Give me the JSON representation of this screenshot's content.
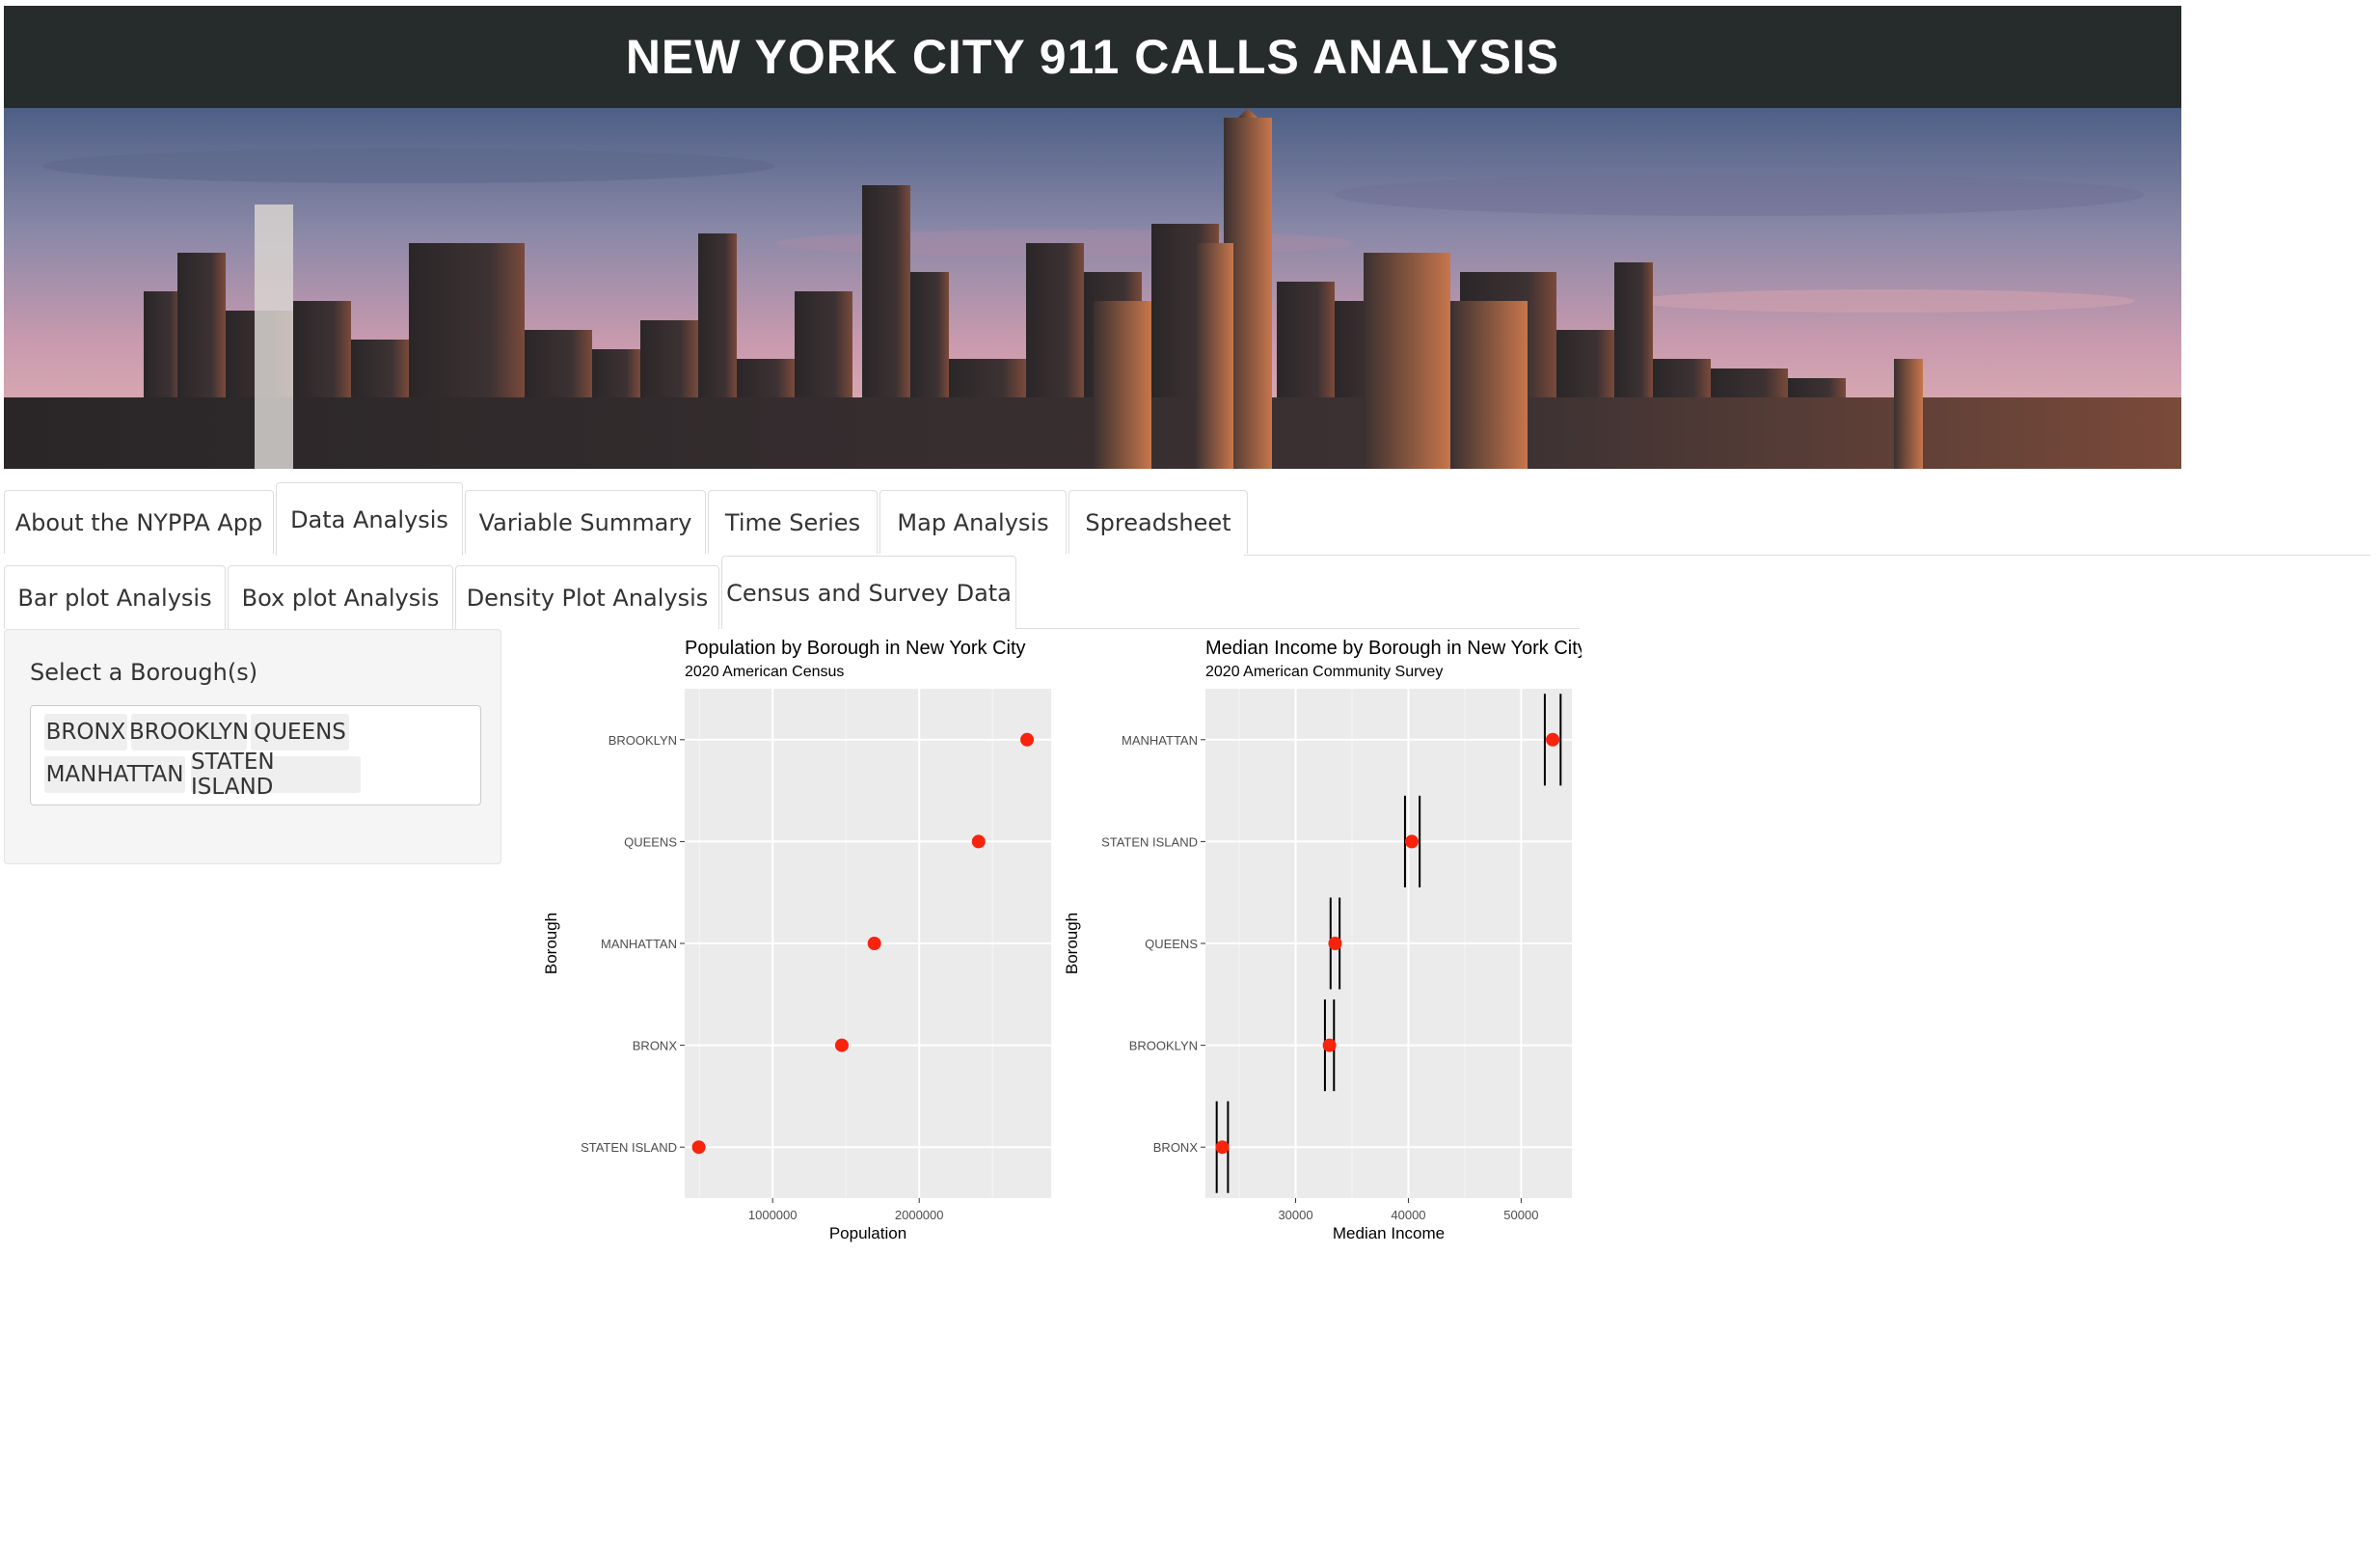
{
  "app": {
    "title": "NEW YORK CITY 911 CALLS ANALYSIS"
  },
  "main_tabs": [
    {
      "label": "About the NYPPA App",
      "active": false
    },
    {
      "label": "Data Analysis",
      "active": true
    },
    {
      "label": "Variable Summary",
      "active": false
    },
    {
      "label": "Time Series",
      "active": false
    },
    {
      "label": "Map Analysis",
      "active": false
    },
    {
      "label": "Spreadsheet",
      "active": false
    }
  ],
  "sub_tabs": [
    {
      "label": "Bar plot Analysis",
      "active": false
    },
    {
      "label": "Box plot Analysis",
      "active": false
    },
    {
      "label": "Density Plot Analysis",
      "active": false
    },
    {
      "label": "Census and Survey Data",
      "active": true
    }
  ],
  "sidebar": {
    "label": "Select a Borough(s)",
    "selected": [
      "BRONX",
      "BROOKLYN",
      "QUEENS",
      "MANHATTAN",
      "STATEN ISLAND"
    ]
  },
  "colors": {
    "point": "#f8230d",
    "panel": "#ebebeb",
    "title_bar": "#262c2b"
  },
  "chart_data": [
    {
      "type": "scatter",
      "title": "Population by Borough in New York City",
      "subtitle": "2020 American Census",
      "xlabel": "Population",
      "ylabel": "Borough",
      "categories": [
        "BROOKLYN",
        "QUEENS",
        "MANHATTAN",
        "BRONX",
        "STATEN ISLAND"
      ],
      "values": [
        2736000,
        2405000,
        1694000,
        1472000,
        496000
      ],
      "xlim": [
        400000,
        2900000
      ],
      "xticks": [
        1000000,
        2000000
      ],
      "xtick_labels": [
        "1000000",
        "2000000"
      ],
      "grid": true
    },
    {
      "type": "scatter",
      "title": "Median Income by Borough in New York City",
      "subtitle": "2020 American Community Survey",
      "xlabel": "Median Income",
      "ylabel": "Borough",
      "categories": [
        "MANHATTAN",
        "STATEN ISLAND",
        "QUEENS",
        "BROOKLYN",
        "BRONX"
      ],
      "values": [
        52800,
        40300,
        33500,
        33000,
        23500
      ],
      "error_low": [
        52100,
        39700,
        33100,
        32600,
        23000
      ],
      "error_high": [
        53500,
        41000,
        33900,
        33400,
        24000
      ],
      "xlim": [
        22000,
        54500
      ],
      "xticks": [
        30000,
        40000,
        50000
      ],
      "xtick_labels": [
        "30000",
        "40000",
        "50000"
      ],
      "grid": true
    }
  ]
}
